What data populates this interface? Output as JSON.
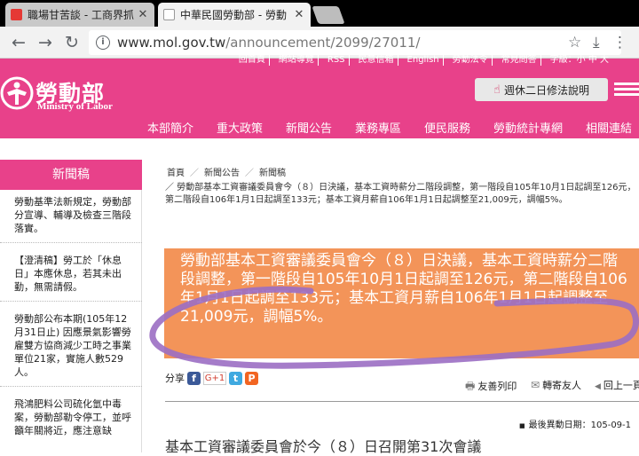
{
  "browser": {
    "tabs": [
      {
        "title": "職場甘苦談 - 工商界抓",
        "active": false,
        "favicon_color": "#e53935"
      },
      {
        "title": "中華民國勞動部 - 勞動",
        "active": true,
        "favicon_color": "#9e9e9e"
      }
    ],
    "close_glyph": "✕",
    "back_glyph": "←",
    "forward_glyph": "→",
    "reload_glyph": "↻",
    "info_glyph": "i",
    "url_host": "www.mol.gov.tw",
    "url_path": "/announcement/2099/27011/",
    "star_glyph": "☆",
    "download_glyph": "⤓",
    "more_glyph": "⋮"
  },
  "site": {
    "top_links": [
      "回首頁",
      "網站導覽",
      "RSS",
      "民意信箱",
      "English",
      "勞動法令",
      "常見問答",
      "字級：小 中 大"
    ],
    "logo_zh": "勞動部",
    "logo_en": "Ministry of Labor",
    "promo_icon": "☝",
    "promo_label": "週休二日修法說明",
    "brand_color": "#e8418a",
    "nav": [
      "本部簡介",
      "重大政策",
      "新聞公告",
      "業務專區",
      "便民服務",
      "勞動統計專網",
      "相關連結"
    ]
  },
  "sidebar": {
    "title": "新聞稿",
    "items": [
      "勞動基準法新規定，勞動部分宣導、輔導及檢查三階段落實。",
      "【澄清稿】勞工於「休息日」本應休息，若其未出勤，無需請假。",
      "勞動部公布本期(105年12月31日止) 因應景氣影響勞雇雙方協商減少工時之事業單位21家，實施人數529人。",
      "飛鴻肥料公司硫化氫中毒案，勞動部勒令停工，並呼籲年關將近，應注意缺"
    ]
  },
  "content": {
    "breadcrumb": [
      "首頁",
      "新聞公告",
      "新聞稿"
    ],
    "breadcrumb_sep": "／",
    "subpath": "／ 勞動部基本工資審議委員會今（８）日決議，基本工資時薪分二階段調整，第一階段自105年10月1日起調至126元，第二階段自106年1月1日起調至133元；基本工資月薪自106年1月1日起調整至21,009元，調幅5%。",
    "headline": "勞動部基本工資審議委員會今（８）日決議，基本工資時薪分二階段調整，第一階段自105年10月1日起調至126元，第二階段自106年1月1日起調至133元；基本工資月薪自106年1月1日起調整至21,009元，調幅5%。",
    "headline_color": "#f39459",
    "share_label": "分享",
    "share_fb": "f",
    "share_gplus": "G+1",
    "share_tw": "t",
    "share_plurk": "P",
    "print_label": "友善列印",
    "forward_label": "轉寄友人",
    "up_label": "回上一頁",
    "print_icon": "🖶",
    "mail_icon": "✉",
    "up_icon": "◀",
    "last_modified_label": "最後異動日期：",
    "last_modified_value": "105-09-1",
    "bullet": "■",
    "next_title": "基本工資審議委員會於今（８）日召開第31次會議"
  }
}
